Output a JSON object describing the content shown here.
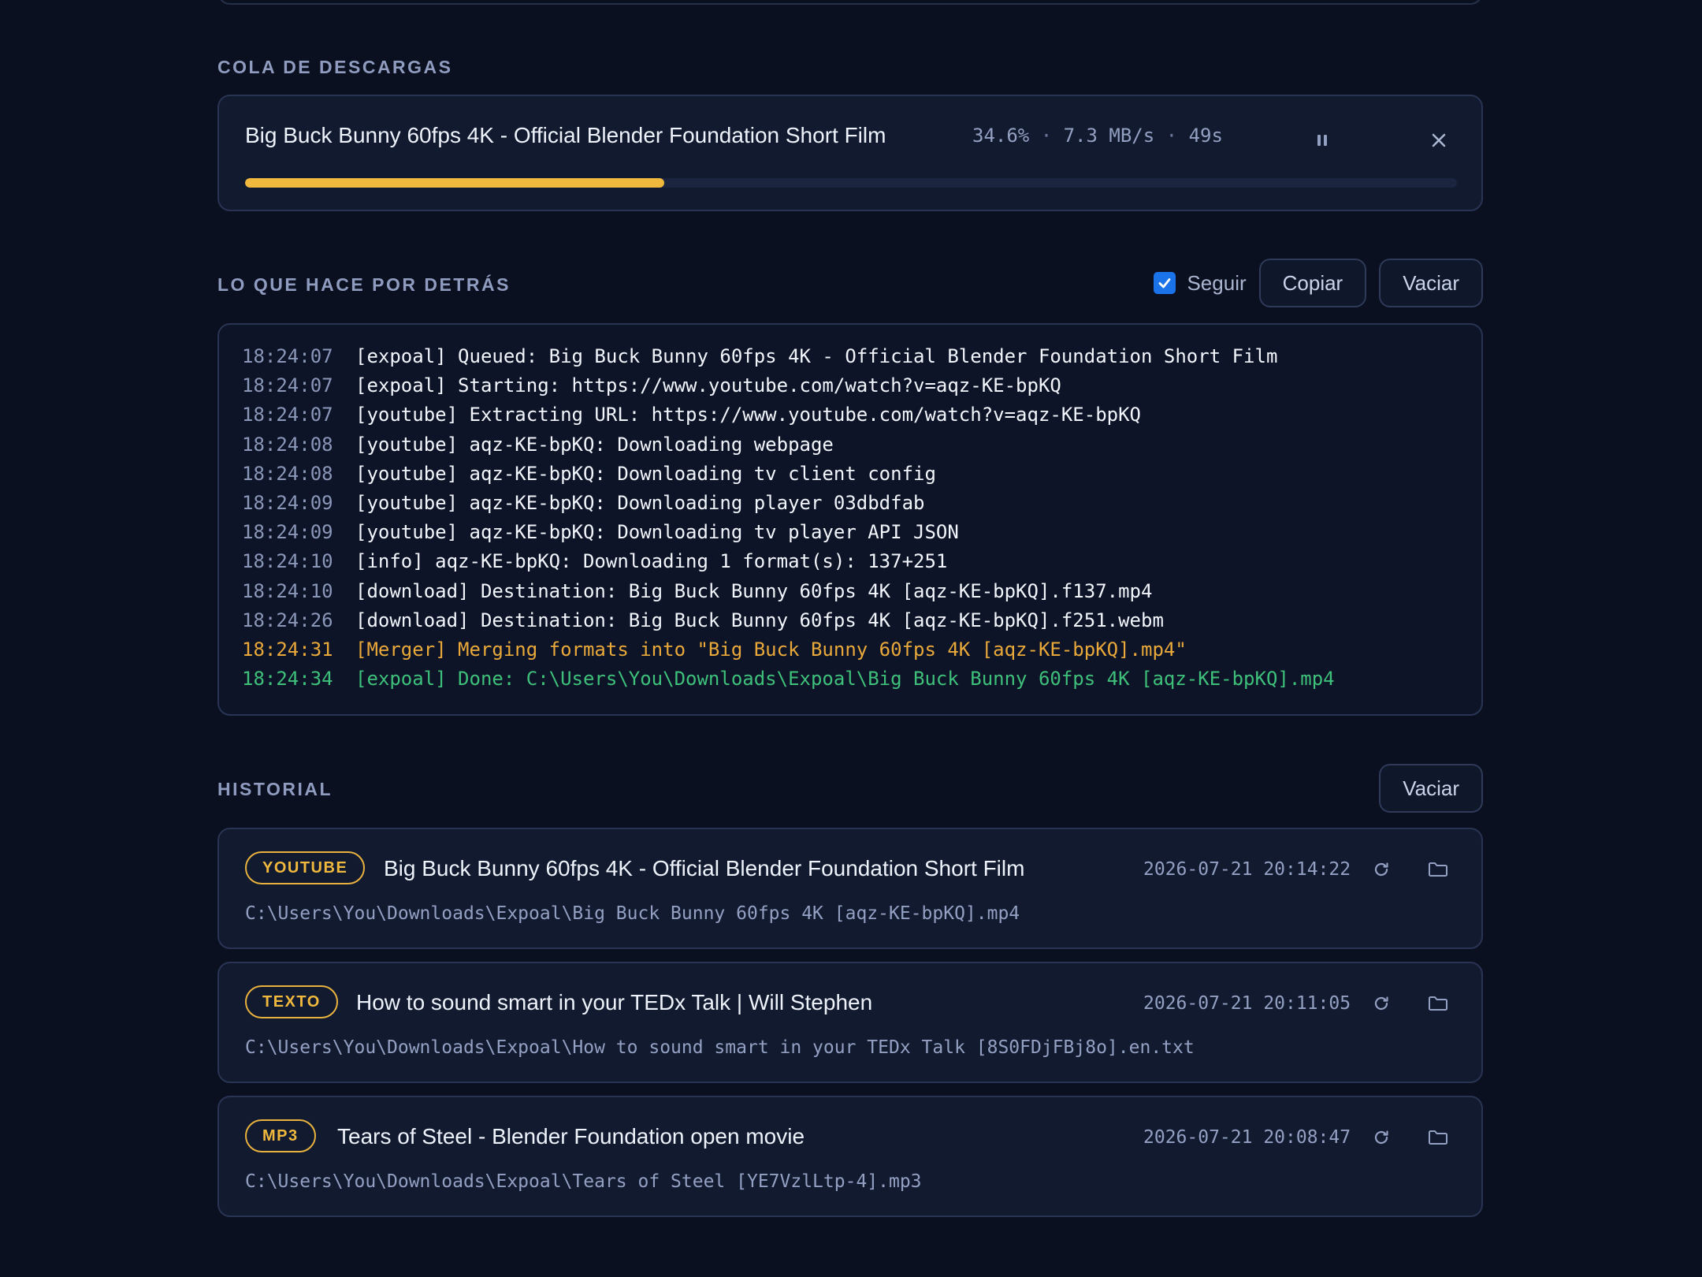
{
  "colors": {
    "accent": "#f0b93e",
    "success": "#3ec07a",
    "warning": "#e9a93a",
    "checkbox": "#1a73e8"
  },
  "queue": {
    "section_title": "COLA DE DESCARGAS",
    "item": {
      "title": "Big Buck Bunny 60fps 4K - Official Blender Foundation Short Film",
      "percent": "34.6%",
      "speed": "7.3 MB/s",
      "eta": "49s",
      "progress": 0.346,
      "pause_icon": "pause-icon",
      "close_icon": "close-icon"
    }
  },
  "log": {
    "section_title": "LO QUE HACE POR DETRÁS",
    "follow_label": "Seguir",
    "follow_checked": true,
    "copy_label": "Copiar",
    "clear_label": "Vaciar",
    "lines": [
      {
        "time": "18:24:07",
        "text": "[expoal] Queued: Big Buck Bunny 60fps 4K - Official Blender Foundation Short Film",
        "level": "info"
      },
      {
        "time": "18:24:07",
        "text": "[expoal] Starting: https://www.youtube.com/watch?v=aqz-KE-bpKQ",
        "level": "info"
      },
      {
        "time": "18:24:07",
        "text": "[youtube] Extracting URL: https://www.youtube.com/watch?v=aqz-KE-bpKQ",
        "level": "info"
      },
      {
        "time": "18:24:08",
        "text": "[youtube] aqz-KE-bpKQ: Downloading webpage",
        "level": "info"
      },
      {
        "time": "18:24:08",
        "text": "[youtube] aqz-KE-bpKQ: Downloading tv client config",
        "level": "info"
      },
      {
        "time": "18:24:09",
        "text": "[youtube] aqz-KE-bpKQ: Downloading player 03dbdfab",
        "level": "info"
      },
      {
        "time": "18:24:09",
        "text": "[youtube] aqz-KE-bpKQ: Downloading tv player API JSON",
        "level": "info"
      },
      {
        "time": "18:24:10",
        "text": "[info] aqz-KE-bpKQ: Downloading 1 format(s): 137+251",
        "level": "info"
      },
      {
        "time": "18:24:10",
        "text": "[download] Destination: Big Buck Bunny 60fps 4K [aqz-KE-bpKQ].f137.mp4",
        "level": "info"
      },
      {
        "time": "18:24:26",
        "text": "[download] Destination: Big Buck Bunny 60fps 4K [aqz-KE-bpKQ].f251.webm",
        "level": "info"
      },
      {
        "time": "18:24:31",
        "text": "[Merger] Merging formats into \"Big Buck Bunny 60fps 4K [aqz-KE-bpKQ].mp4\"",
        "level": "warn"
      },
      {
        "time": "18:24:34",
        "text": "[expoal] Done: C:\\Users\\You\\Downloads\\Expoal\\Big Buck Bunny 60fps 4K [aqz-KE-bpKQ].mp4",
        "level": "ok"
      }
    ]
  },
  "history": {
    "section_title": "HISTORIAL",
    "clear_label": "Vaciar",
    "items": [
      {
        "badge": "YOUTUBE",
        "title": "Big Buck Bunny 60fps 4K - Official Blender Foundation Short Film",
        "date": "2026-07-21 20:14:22",
        "path": "C:\\Users\\You\\Downloads\\Expoal\\Big Buck Bunny 60fps 4K [aqz-KE-bpKQ].mp4"
      },
      {
        "badge": "TEXTO",
        "title": "How to sound smart in your TEDx Talk | Will Stephen",
        "date": "2026-07-21 20:11:05",
        "path": "C:\\Users\\You\\Downloads\\Expoal\\How to sound smart in your TEDx Talk [8S0FDjFBj8o].en.txt"
      },
      {
        "badge": "MP3",
        "title": "Tears of Steel - Blender Foundation open movie",
        "date": "2026-07-21 20:08:47",
        "path": "C:\\Users\\You\\Downloads\\Expoal\\Tears of Steel [YE7VzlLtp-4].mp3"
      }
    ]
  }
}
